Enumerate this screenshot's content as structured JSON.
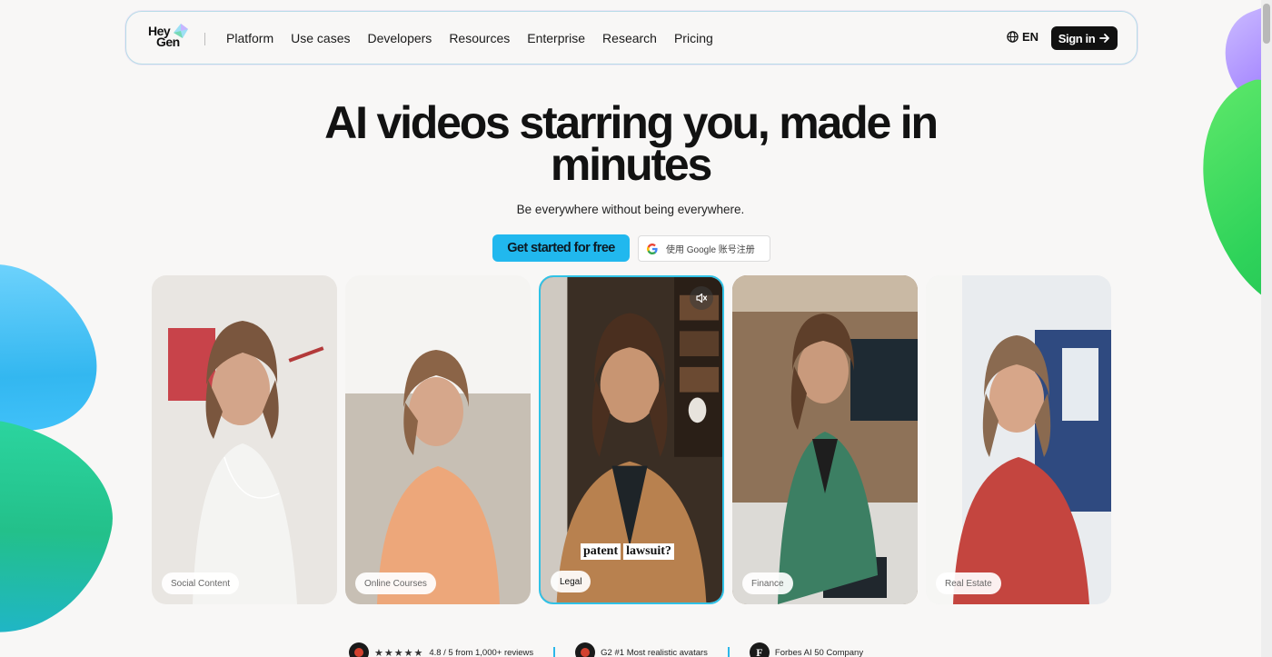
{
  "brand": {
    "logo_line1": "Hey",
    "logo_line2": "Gen"
  },
  "nav": {
    "links": [
      "Platform",
      "Use cases",
      "Developers",
      "Resources",
      "Enterprise",
      "Research",
      "Pricing"
    ],
    "language": "EN",
    "signin_label": "Sign in"
  },
  "hero": {
    "title": "AI videos starring you, made in minutes",
    "subtitle": "Be everywhere without being everywhere.",
    "cta_primary": "Get started for free",
    "cta_google": "使用 Google 账号注册"
  },
  "cards": [
    {
      "label": "Social Content"
    },
    {
      "label": "Online Courses"
    },
    {
      "label": "Legal",
      "caption_words": [
        "patent",
        "lawsuit?"
      ]
    },
    {
      "label": "Finance"
    },
    {
      "label": "Real Estate"
    }
  ],
  "proof": {
    "rating_text": "4.8 / 5 from 1,000+ reviews",
    "stars": "★★★★★",
    "g2_text": "G2 #1 Most realistic avatars",
    "forbes_text": "Forbes AI 50 Company",
    "forbes_letter": "F"
  },
  "colors": {
    "accent": "#21b8ee",
    "dark": "#111111",
    "background": "#f8f7f6",
    "active_border": "#30c2e6"
  },
  "icons": {
    "language": "globe-icon",
    "signin": "arrow-right-icon",
    "google": "google-g-icon",
    "mute": "speaker-muted-icon"
  }
}
